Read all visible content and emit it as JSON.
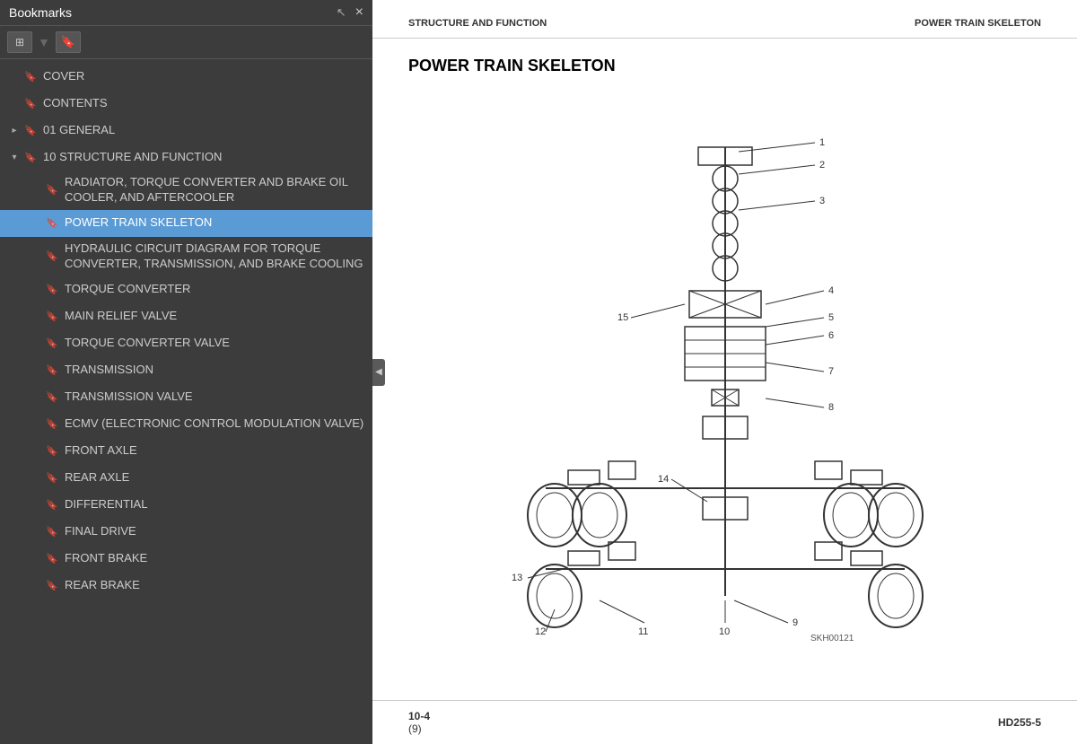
{
  "left_panel": {
    "title": "Bookmarks",
    "close_label": "×",
    "toolbar": {
      "grid_icon": "⊞",
      "bookmark_icon": "🔖"
    },
    "items": [
      {
        "id": "cover",
        "label": "COVER",
        "indent": 0,
        "has_arrow": false,
        "arrow_open": false,
        "active": false
      },
      {
        "id": "contents",
        "label": "CONTENTS",
        "indent": 0,
        "has_arrow": false,
        "arrow_open": false,
        "active": false
      },
      {
        "id": "general",
        "label": "01 GENERAL",
        "indent": 0,
        "has_arrow": true,
        "arrow_open": false,
        "active": false
      },
      {
        "id": "structure",
        "label": "10 STRUCTURE AND FUNCTION",
        "indent": 0,
        "has_arrow": true,
        "arrow_open": true,
        "active": false
      },
      {
        "id": "radiator",
        "label": "RADIATOR, TORQUE CONVERTER AND BRAKE OIL COOLER, AND AFTERCOOLER",
        "indent": 1,
        "has_arrow": false,
        "arrow_open": false,
        "active": false
      },
      {
        "id": "power-train",
        "label": "POWER TRAIN SKELETON",
        "indent": 1,
        "has_arrow": false,
        "arrow_open": false,
        "active": true
      },
      {
        "id": "hydraulic",
        "label": "HYDRAULIC CIRCUIT DIAGRAM FOR TORQUE CONVERTER, TRANSMISSION, AND BRAKE COOLING",
        "indent": 1,
        "has_arrow": false,
        "arrow_open": false,
        "active": false
      },
      {
        "id": "torque-converter",
        "label": "TORQUE CONVERTER",
        "indent": 1,
        "has_arrow": false,
        "arrow_open": false,
        "active": false
      },
      {
        "id": "main-relief",
        "label": "MAIN RELIEF VALVE",
        "indent": 1,
        "has_arrow": false,
        "arrow_open": false,
        "active": false
      },
      {
        "id": "torque-converter-valve",
        "label": "TORQUE CONVERTER VALVE",
        "indent": 1,
        "has_arrow": false,
        "arrow_open": false,
        "active": false
      },
      {
        "id": "transmission",
        "label": "TRANSMISSION",
        "indent": 1,
        "has_arrow": false,
        "arrow_open": false,
        "active": false
      },
      {
        "id": "transmission-valve",
        "label": "TRANSMISSION VALVE",
        "indent": 1,
        "has_arrow": false,
        "arrow_open": false,
        "active": false
      },
      {
        "id": "ecmv",
        "label": "ECMV (ELECTRONIC CONTROL MODULATION VALVE)",
        "indent": 1,
        "has_arrow": false,
        "arrow_open": false,
        "active": false
      },
      {
        "id": "front-axle",
        "label": "FRONT AXLE",
        "indent": 1,
        "has_arrow": false,
        "arrow_open": false,
        "active": false
      },
      {
        "id": "rear-axle",
        "label": "REAR AXLE",
        "indent": 1,
        "has_arrow": false,
        "arrow_open": false,
        "active": false
      },
      {
        "id": "differential",
        "label": "DIFFERENTIAL",
        "indent": 1,
        "has_arrow": false,
        "arrow_open": false,
        "active": false
      },
      {
        "id": "final-drive",
        "label": "FINAL DRIVE",
        "indent": 1,
        "has_arrow": false,
        "arrow_open": false,
        "active": false
      },
      {
        "id": "front-brake",
        "label": "FRONT BRAKE",
        "indent": 1,
        "has_arrow": false,
        "arrow_open": false,
        "active": false
      },
      {
        "id": "rear-brake",
        "label": "REAR BRAKE",
        "indent": 1,
        "has_arrow": false,
        "arrow_open": false,
        "active": false
      }
    ]
  },
  "right_panel": {
    "header_left": "STRUCTURE AND FUNCTION",
    "header_right": "POWER TRAIN SKELETON",
    "doc_title": "POWER TRAIN SKELETON",
    "diagram_ref": "SKH00121",
    "footer_page": "10-4",
    "footer_sub": "(9)",
    "footer_model": "HD255-5"
  }
}
